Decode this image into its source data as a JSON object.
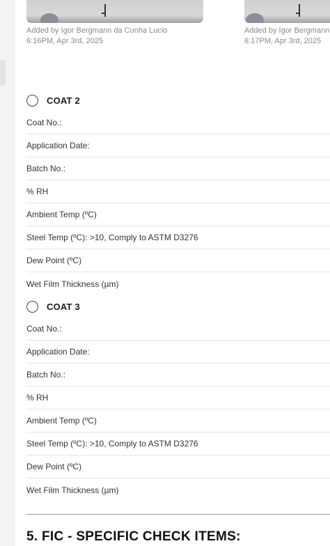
{
  "photos": [
    {
      "added_by": "Added by Igor Bergmann da Cunha Lucio",
      "timestamp": "6:16PM, Apr 3rd, 2025"
    },
    {
      "added_by": "Added by Igor Bergmann",
      "timestamp": "6:17PM, Apr 3rd, 2025"
    }
  ],
  "coats": [
    {
      "title": "COAT 2",
      "fields": [
        "Coat No.:",
        "Application Date:",
        "Batch No.:",
        "% RH",
        "Ambient Temp (ºC)",
        "Steel Temp (ºC): >10, Comply to ASTM D3276",
        "Dew Point (ºC)",
        "Wet Film Thickness (µm)"
      ]
    },
    {
      "title": "COAT 3",
      "fields": [
        "Coat No.:",
        "Application Date:",
        "Batch No.:",
        "% RH",
        "Ambient Temp (ºC)",
        "Steel Temp (ºC): >10, Comply to ASTM D3276",
        "Dew Point (ºC)",
        "Wet Film Thickness (µm)"
      ]
    }
  ],
  "next_section": {
    "title": "5. FIC - SPECIFIC CHECK ITEMS:"
  }
}
